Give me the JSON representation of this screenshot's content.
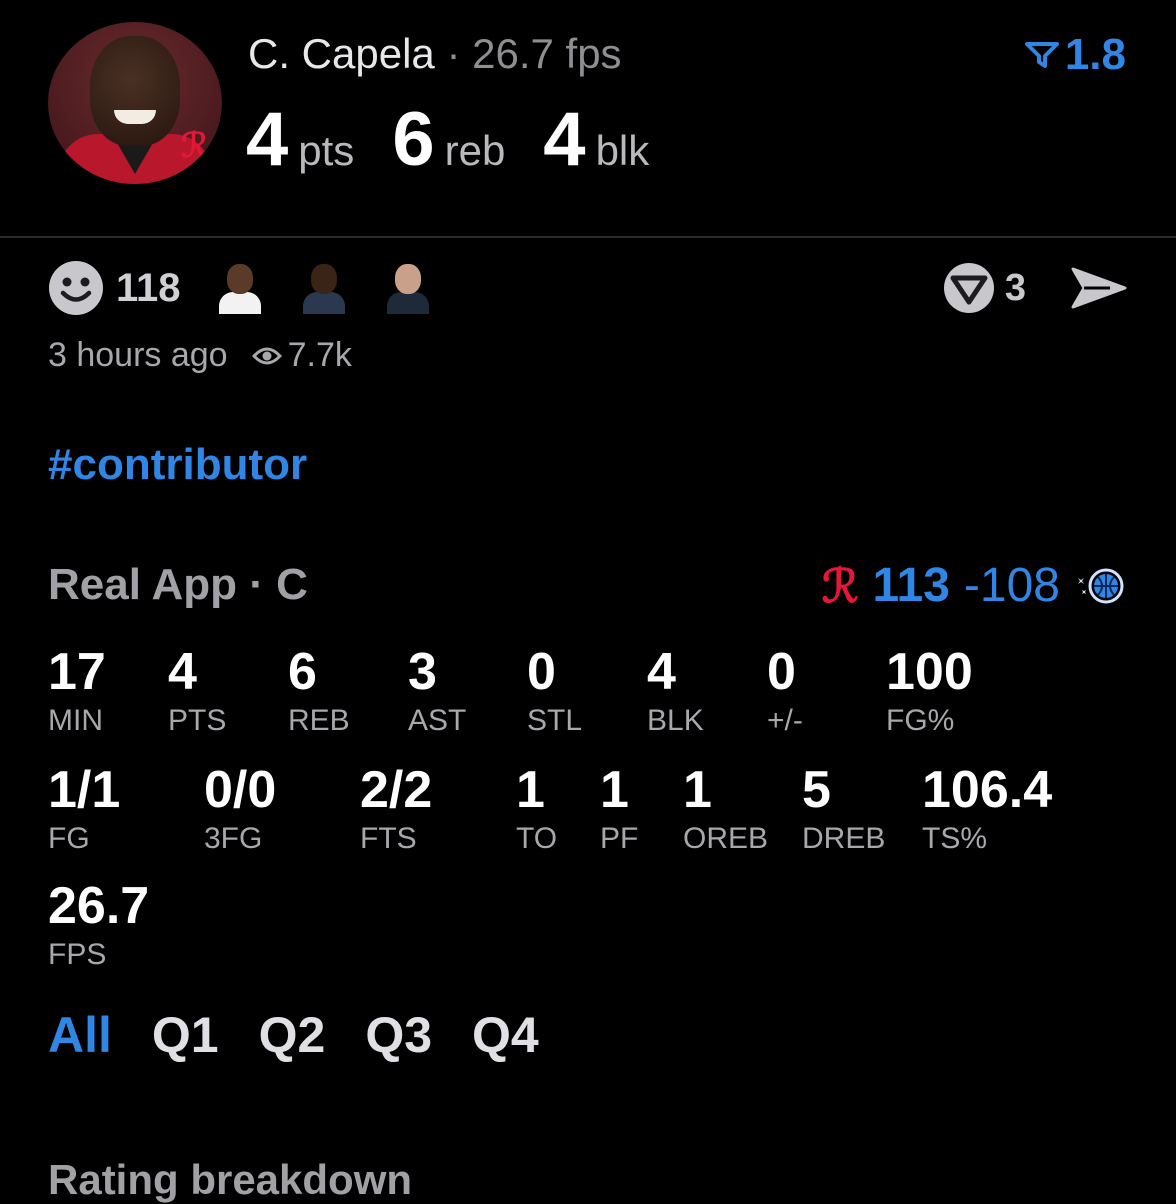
{
  "player": {
    "name": "C. Capela",
    "separator": "·",
    "fps_text": "26.7 fps",
    "rank_value": "1.8",
    "stats": [
      {
        "value": "4",
        "label": "pts"
      },
      {
        "value": "6",
        "label": "reb"
      },
      {
        "value": "4",
        "label": "blk"
      }
    ]
  },
  "social": {
    "reaction_count": "118",
    "vote_count": "3",
    "time_ago": "3 hours ago",
    "views": "7.7k",
    "hashtag": "#contributor"
  },
  "game": {
    "source": "Real App · C",
    "home_score": "113",
    "dash": "-",
    "away_score": "108",
    "home_color": "#e31837",
    "away_color": "#2f86e4"
  },
  "box": {
    "row1": [
      {
        "value": "17",
        "label": "MIN"
      },
      {
        "value": "4",
        "label": "PTS"
      },
      {
        "value": "6",
        "label": "REB"
      },
      {
        "value": "3",
        "label": "AST"
      },
      {
        "value": "0",
        "label": "STL"
      },
      {
        "value": "4",
        "label": "BLK"
      },
      {
        "value": "0",
        "label": "+/-"
      },
      {
        "value": "100",
        "label": "FG%"
      }
    ],
    "row2": [
      {
        "value": "1/1",
        "label": "FG"
      },
      {
        "value": "0/0",
        "label": "3FG"
      },
      {
        "value": "2/2",
        "label": "FTS"
      },
      {
        "value": "1",
        "label": "TO"
      },
      {
        "value": "1",
        "label": "PF"
      },
      {
        "value": "1",
        "label": "OREB"
      },
      {
        "value": "5",
        "label": "DREB"
      },
      {
        "value": "106.4",
        "label": "TS%"
      }
    ],
    "row3": [
      {
        "value": "26.7",
        "label": "FPS"
      }
    ]
  },
  "tabs": [
    "All",
    "Q1",
    "Q2",
    "Q3",
    "Q4"
  ],
  "section_title": "Rating breakdown",
  "colors": {
    "accent": "#2f86e4",
    "background": "#000000"
  },
  "icons": [
    "filter-rank-icon",
    "smiley-icon",
    "vote-icon",
    "share-arrow-icon",
    "eye-icon",
    "rockets-logo-icon",
    "magic-logo-icon"
  ]
}
